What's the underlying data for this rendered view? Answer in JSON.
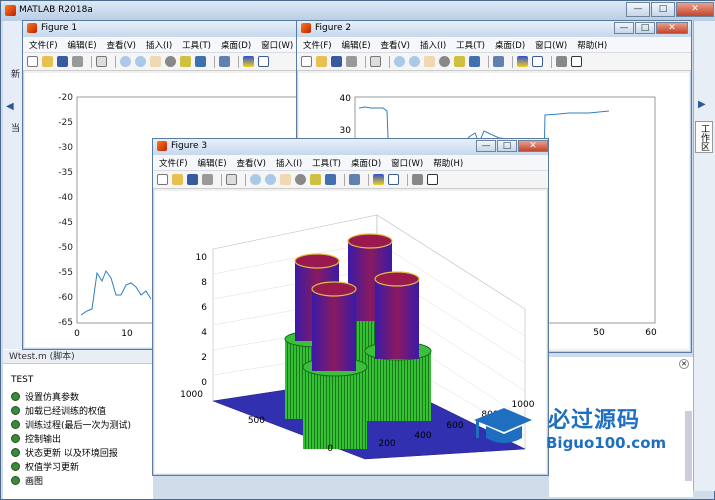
{
  "main": {
    "title": "MATLAB R2018a",
    "window_buttons": [
      "—",
      "□",
      "✕"
    ],
    "left_partial": [
      "新",
      "当"
    ],
    "workspace_tab": "工作区",
    "panel_title": "Wtest.m (脚本)",
    "list_title": "TEST",
    "list_items": [
      "设置仿真参数",
      "加载已经训练的权值",
      "训练过程(最后一次为测试)",
      "控制输出",
      "状态更新 以及环境回报",
      "权值学习更新",
      "画图"
    ]
  },
  "menu_items": [
    "文件(F)",
    "编辑(E)",
    "查看(V)",
    "插入(I)",
    "工具(T)",
    "桌面(D)",
    "窗口(W)",
    "帮助(H)"
  ],
  "figure1": {
    "title": "Figure 1",
    "yticks": [
      "-20",
      "-25",
      "-30",
      "-35",
      "-40",
      "-45",
      "-50",
      "-55",
      "-60",
      "-65"
    ],
    "xticks": [
      "0",
      "10"
    ]
  },
  "figure2": {
    "title": "Figure 2",
    "yticks": [
      "40",
      "30"
    ],
    "xticks": [
      "50",
      "60"
    ]
  },
  "figure3": {
    "title": "Figure 3",
    "zticks": [
      "10",
      "8",
      "6",
      "4",
      "2",
      "0"
    ],
    "yticks": [
      "1000",
      "500",
      "0"
    ],
    "xticks": [
      "200",
      "400",
      "600",
      "800",
      "1000"
    ]
  },
  "watermark": {
    "text": "必过源码",
    "url": "Biguo100.com"
  },
  "colors": {
    "line": "#2f7fc0",
    "cyl_top": "#9a1a50",
    "cyl_side": "#4a1aa0",
    "base": "#2f2fa8",
    "grass": "#2fc02f"
  }
}
